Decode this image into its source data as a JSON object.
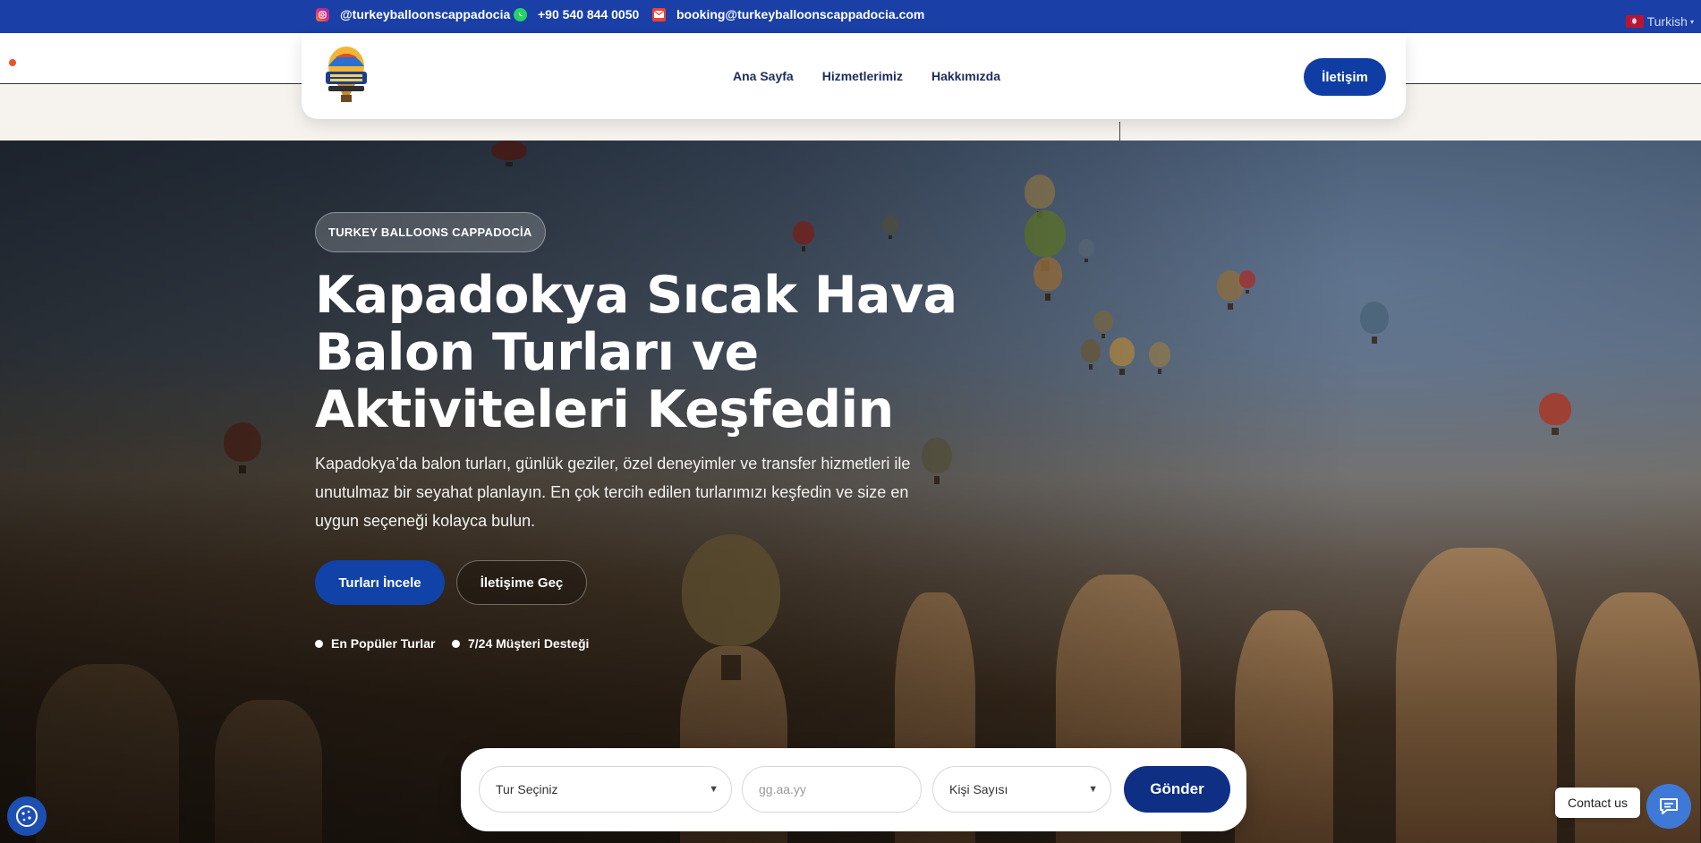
{
  "topbar": {
    "instagram": "@turkeyballoonscappadocia",
    "phone": "+90 540 844 0050",
    "email": "booking@turkeyballoonscappadocia.com",
    "language": "Turkish"
  },
  "nav": {
    "items": [
      "Ana Sayfa",
      "Hizmetlerimiz",
      "Hakkımızda"
    ],
    "cta": "İletişim"
  },
  "hero": {
    "badge": "TURKEY BALLOONS CAPPADOCİA",
    "title": "Kapadokya Sıcak Hava Balon Turları ve Aktiviteleri Keşfedin",
    "subtitle": "Kapadokya’da balon turları, günlük geziler, özel deneyimler ve transfer hizmetleri ile unutulmaz bir seyahat planlayın. En çok tercih edilen turlarımızı keşfedin ve size en uygun seçeneği kolayca bulun.",
    "primary_button": "Turları İncele",
    "secondary_button": "İletişime Geç",
    "features": [
      "En Popüler Turlar",
      "7/24 Müşteri Desteği"
    ]
  },
  "booking": {
    "tour_select": "Tur Seçiniz",
    "date_placeholder": "gg.aa.yy",
    "people_select": "Kişi Sayısı",
    "submit": "Gönder"
  },
  "floating": {
    "contact_label": "Contact us"
  },
  "colors": {
    "brand_blue": "#1a3fa6",
    "button_blue": "#1042a7",
    "submit_navy": "#0f2f85"
  }
}
